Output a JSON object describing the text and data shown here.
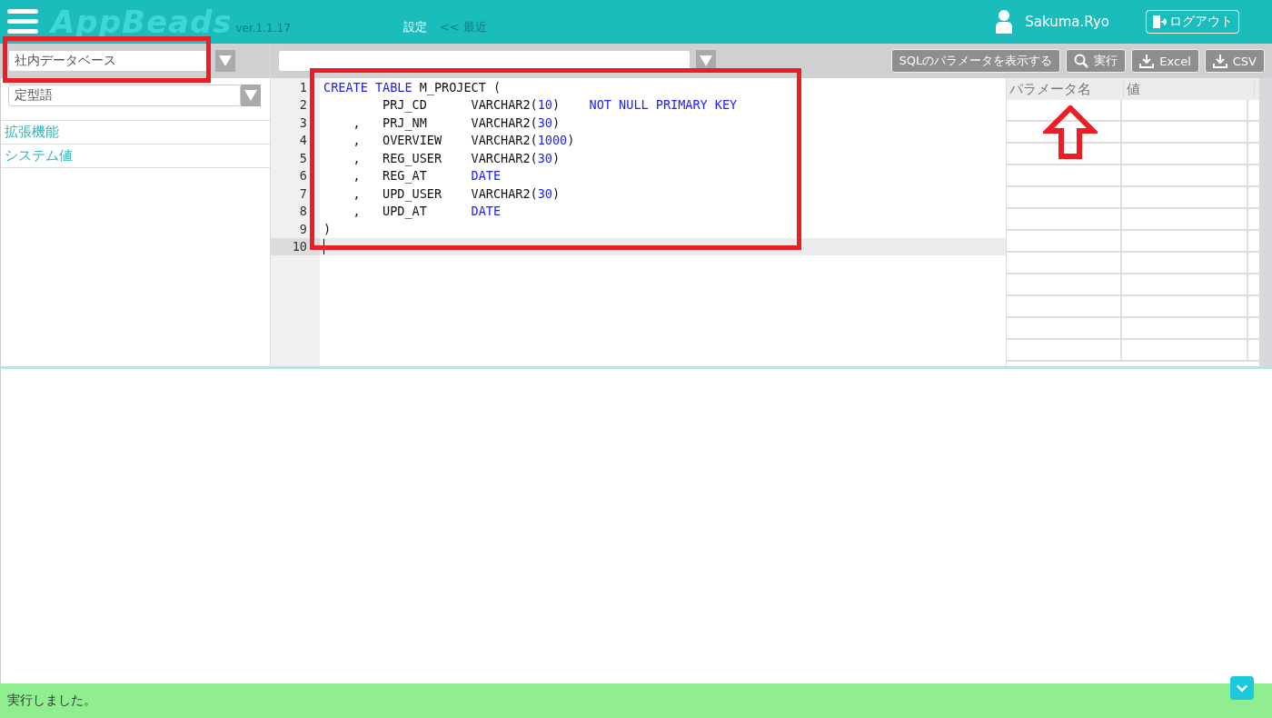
{
  "header": {
    "logo": "AppBeads",
    "version": "ver.1.1.17",
    "nav": [
      {
        "label": "設定",
        "selected": true
      },
      {
        "label": "<< 最近",
        "selected": false
      }
    ],
    "user": "Sakuma.Ryo",
    "logout": "ログアウト"
  },
  "toolbar": {
    "database": "社内データベース",
    "buttons": [
      {
        "kind": "text",
        "label": "SQLのパラメータを表示する"
      },
      {
        "kind": "search",
        "label": "実行"
      },
      {
        "kind": "download",
        "label": "Excel"
      },
      {
        "kind": "download",
        "label": "CSV"
      }
    ]
  },
  "sidebar": {
    "phrase_select": "定型語",
    "items": [
      {
        "label": "拡張機能"
      },
      {
        "label": "システム値"
      }
    ]
  },
  "editor": {
    "lines": [
      {
        "number": "1",
        "active": false,
        "tokens": [
          {
            "kind": "keyword",
            "text": "CREATE TABLE"
          },
          {
            "kind": "plain",
            "text": " M_PROJECT ("
          }
        ]
      },
      {
        "number": "2",
        "active": false,
        "tokens": [
          {
            "kind": "plain",
            "text": "        PRJ_CD      VARCHAR2("
          },
          {
            "kind": "number",
            "text": "10"
          },
          {
            "kind": "plain",
            "text": ")    "
          },
          {
            "kind": "keyword",
            "text": "NOT NULL PRIMARY KEY"
          }
        ]
      },
      {
        "number": "3",
        "active": false,
        "tokens": [
          {
            "kind": "plain",
            "text": "    ,   PRJ_NM      VARCHAR2("
          },
          {
            "kind": "number",
            "text": "30"
          },
          {
            "kind": "plain",
            "text": ")"
          }
        ]
      },
      {
        "number": "4",
        "active": false,
        "tokens": [
          {
            "kind": "plain",
            "text": "    ,   OVERVIEW    VARCHAR2("
          },
          {
            "kind": "number",
            "text": "1000"
          },
          {
            "kind": "plain",
            "text": ")"
          }
        ]
      },
      {
        "number": "5",
        "active": false,
        "tokens": [
          {
            "kind": "plain",
            "text": "    ,   REG_USER    VARCHAR2("
          },
          {
            "kind": "number",
            "text": "30"
          },
          {
            "kind": "plain",
            "text": ")"
          }
        ]
      },
      {
        "number": "6",
        "active": false,
        "tokens": [
          {
            "kind": "plain",
            "text": "    ,   REG_AT      "
          },
          {
            "kind": "keyword",
            "text": "DATE"
          }
        ]
      },
      {
        "number": "7",
        "active": false,
        "tokens": [
          {
            "kind": "plain",
            "text": "    ,   UPD_USER    VARCHAR2("
          },
          {
            "kind": "number",
            "text": "30"
          },
          {
            "kind": "plain",
            "text": ")"
          }
        ]
      },
      {
        "number": "8",
        "active": false,
        "tokens": [
          {
            "kind": "plain",
            "text": "    ,   UPD_AT      "
          },
          {
            "kind": "keyword",
            "text": "DATE"
          }
        ]
      },
      {
        "number": "9",
        "active": false,
        "tokens": [
          {
            "kind": "plain",
            "text": ")"
          }
        ]
      },
      {
        "number": "10",
        "active": true
      }
    ]
  },
  "parameters": {
    "columns": [
      "パラメータ名",
      "値"
    ]
  },
  "status_bar": {
    "message": "実行しました。"
  }
}
